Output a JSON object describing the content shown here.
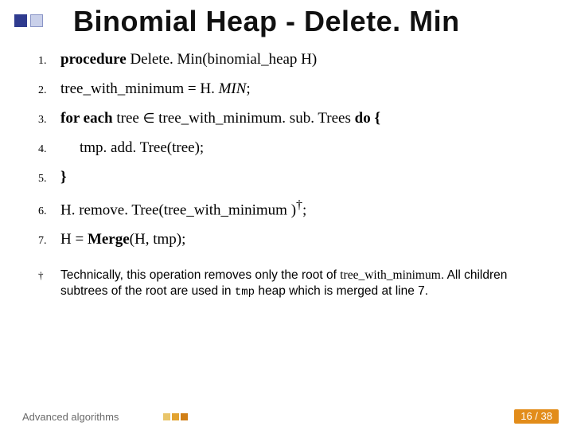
{
  "title": "Binomial Heap - Delete. Min",
  "lines": {
    "n1": "1.",
    "l1a": "procedure",
    "l1b": " Delete. Min(binomial_heap H)",
    "n2": "2.",
    "l2a": "tree_with_minimum = H. ",
    "l2b": "MIN",
    "l2c": ";",
    "n3": "3.",
    "l3a": "for each ",
    "l3b": "tree ",
    "l3c": "∈",
    "l3d": " tree_with_minimum. sub. Trees  ",
    "l3e": "do {",
    "n4": "4.",
    "l4": "tmp. add. Tree(tree);",
    "n5": "5.",
    "l5": "}",
    "n6": "6.",
    "l6a": "H. remove. Tree(tree_with_minimum )",
    "l6b": "†",
    "l6c": ";",
    "n7": "7.",
    "l7a": "H = ",
    "l7b": "Merge",
    "l7c": "(H, tmp);"
  },
  "footnote": {
    "mark": "†",
    "t1": "Technically, this operation removes only the root of ",
    "t2": "tree_with_minimum",
    "t3": ". All children subtrees of the root are used in ",
    "t4": "tmp",
    "t5": " heap which is merged at line 7."
  },
  "footer": {
    "label": "Advanced algorithms",
    "pager": "16 / 38"
  }
}
